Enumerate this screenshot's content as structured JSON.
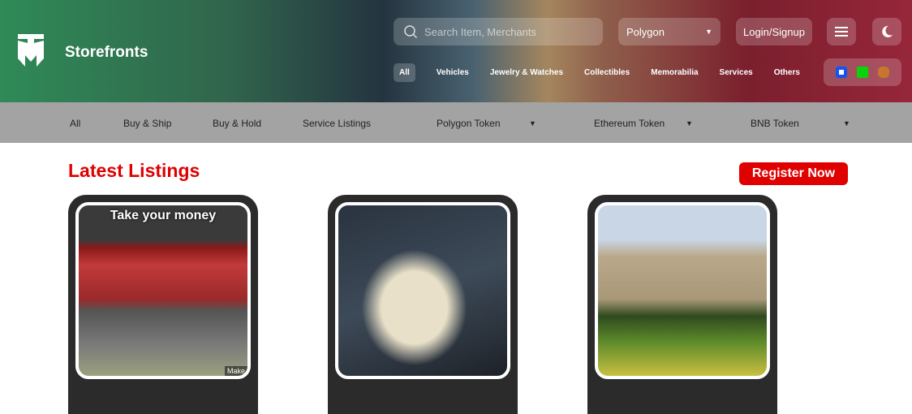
{
  "brand": {
    "name": "Storefronts"
  },
  "search": {
    "placeholder": "Search Item, Merchants"
  },
  "network": {
    "selected": "Polygon"
  },
  "login_label": "Login/Signup",
  "categories": [
    "All",
    "Vehicles",
    "Jewelry & Watches",
    "Collectibles",
    "Memorabilia",
    "Services",
    "Others"
  ],
  "subnav": {
    "items": [
      "All",
      "Buy & Ship",
      "Buy & Hold",
      "Service Listings"
    ],
    "dropdowns": [
      "Polygon Token",
      "Ethereum Token",
      "BNB Token"
    ]
  },
  "section_title": "Latest Listings",
  "register_label": "Register Now",
  "cards": [
    {
      "caption": "Take your money",
      "badge": "Make"
    },
    {},
    {}
  ],
  "colors": {
    "accent": "#e00000"
  }
}
